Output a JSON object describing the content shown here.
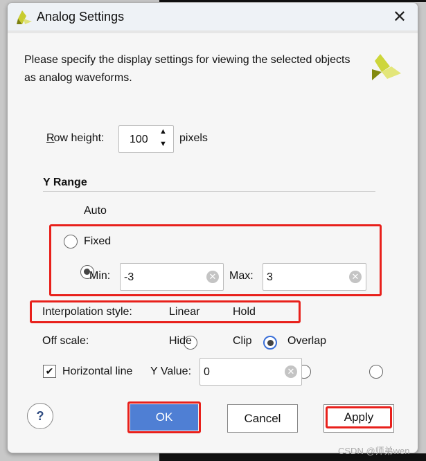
{
  "dialog": {
    "title": "Analog Settings",
    "description": "Please specify the display settings for viewing the selected objects as analog waveforms."
  },
  "row_height": {
    "label": "Row height:",
    "value": "100",
    "unit": "pixels"
  },
  "y_range": {
    "heading": "Y Range",
    "auto": "Auto",
    "fixed": "Fixed",
    "selected": "Fixed",
    "min_label": "Min:",
    "min_value": "-3",
    "max_label": "Max:",
    "max_value": "3"
  },
  "interpolation": {
    "label": "Interpolation style:",
    "linear": "Linear",
    "hold": "Hold",
    "selected": "Hold"
  },
  "off_scale": {
    "label": "Off scale:",
    "hide": "Hide",
    "clip": "Clip",
    "overlap": "Overlap",
    "selected": "Hide"
  },
  "horizontal_line": {
    "label": "Horizontal line",
    "checked": true,
    "y_label": "Y Value:",
    "y_value": "0"
  },
  "buttons": {
    "help": "?",
    "ok": "OK",
    "cancel": "Cancel",
    "apply": "Apply"
  },
  "watermark": "CSDN @师弟wen",
  "colors": {
    "ok": "#4f7fd4",
    "highlight": "#e8201b"
  }
}
